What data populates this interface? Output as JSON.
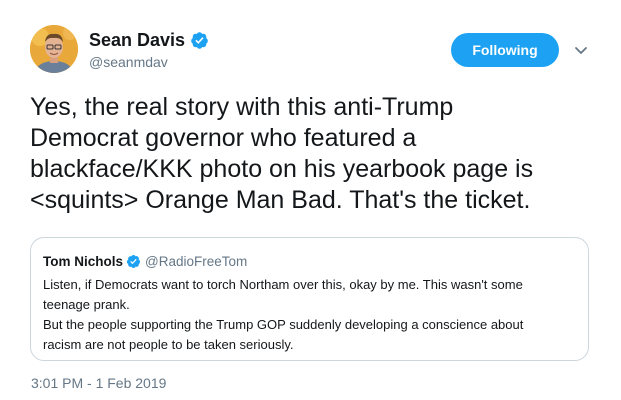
{
  "author": {
    "name": "Sean Davis",
    "handle": "@seanmdav",
    "verified_color": "#1da1f2"
  },
  "actions": {
    "follow_label": "Following",
    "follow_color": "#1da1f2",
    "menu_icon": "chevron-down-icon"
  },
  "tweet": {
    "text": "Yes, the real story with this anti-Trump\nDemocrat governor who featured a\nblackface/KKK photo on his yearbook page is\n<squints> Orange Man Bad. That's the ticket.",
    "timestamp": "3:01 PM - 1 Feb 2019"
  },
  "quoted_tweet": {
    "name": "Tom Nichols",
    "handle": "@RadioFreeTom",
    "text": "Listen, if Democrats want to torch Northam over this, okay by me. This wasn't some\nteenage prank.\nBut the people supporting the Trump GOP suddenly developing a conscience about\nracism are not people to be taken seriously."
  }
}
